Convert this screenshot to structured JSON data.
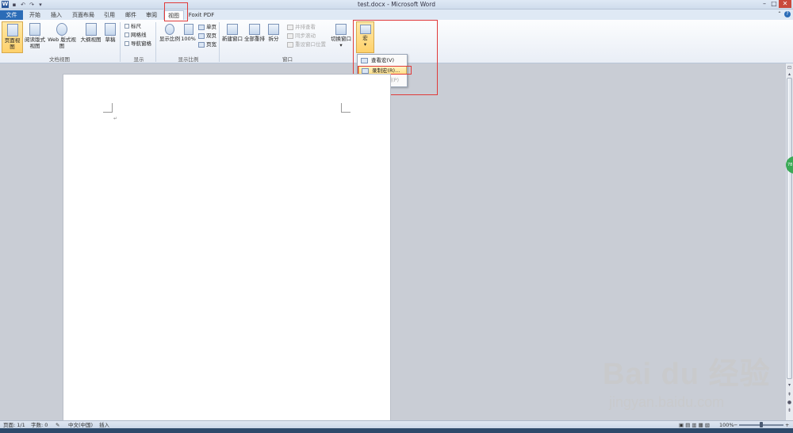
{
  "window": {
    "title": "test.docx - Microsoft Word",
    "app_icon": "W",
    "controls": [
      "–",
      "□",
      "✕"
    ]
  },
  "qat": {
    "items": [
      "save-icon",
      "undo-icon",
      "redo-icon",
      "customize-icon"
    ]
  },
  "tabs": [
    "文件",
    "开始",
    "插入",
    "页面布局",
    "引用",
    "邮件",
    "审阅",
    "视图",
    "Foxit PDF"
  ],
  "active_tab": "视图",
  "ribbon": {
    "views": {
      "group_label": "文档视图",
      "buttons": [
        "页面视图",
        "阅读版式视图",
        "Web 版式视图",
        "大纲视图",
        "草稿"
      ]
    },
    "show": {
      "group_label": "显示",
      "checkboxes": [
        "标尺",
        "网格线",
        "导航窗格"
      ]
    },
    "zoom": {
      "group_label": "显示比例",
      "buttons": [
        "显示比例",
        "100%"
      ],
      "small": [
        "单页",
        "双页",
        "页宽"
      ]
    },
    "window": {
      "group_label": "窗口",
      "buttons": [
        "新建窗口",
        "全部重排",
        "拆分"
      ],
      "small": [
        "并排查看",
        "同步滚动",
        "重设窗口位置"
      ],
      "switch": "切换窗口"
    },
    "macros": {
      "label": "宏"
    }
  },
  "macro_menu": {
    "items": [
      "查看宏(V)",
      "录制宏(R)...",
      "暂停录制(P)"
    ]
  },
  "status": {
    "page": "页面: 1/1",
    "words": "字数: 0",
    "language": "中文(中国)",
    "mode": "插入",
    "zoom": "100%",
    "zoom_level": 0.5
  },
  "watermark": {
    "logo": "Bai du 经验",
    "url": "jingyan.baidu.com"
  },
  "side_badge": "78"
}
